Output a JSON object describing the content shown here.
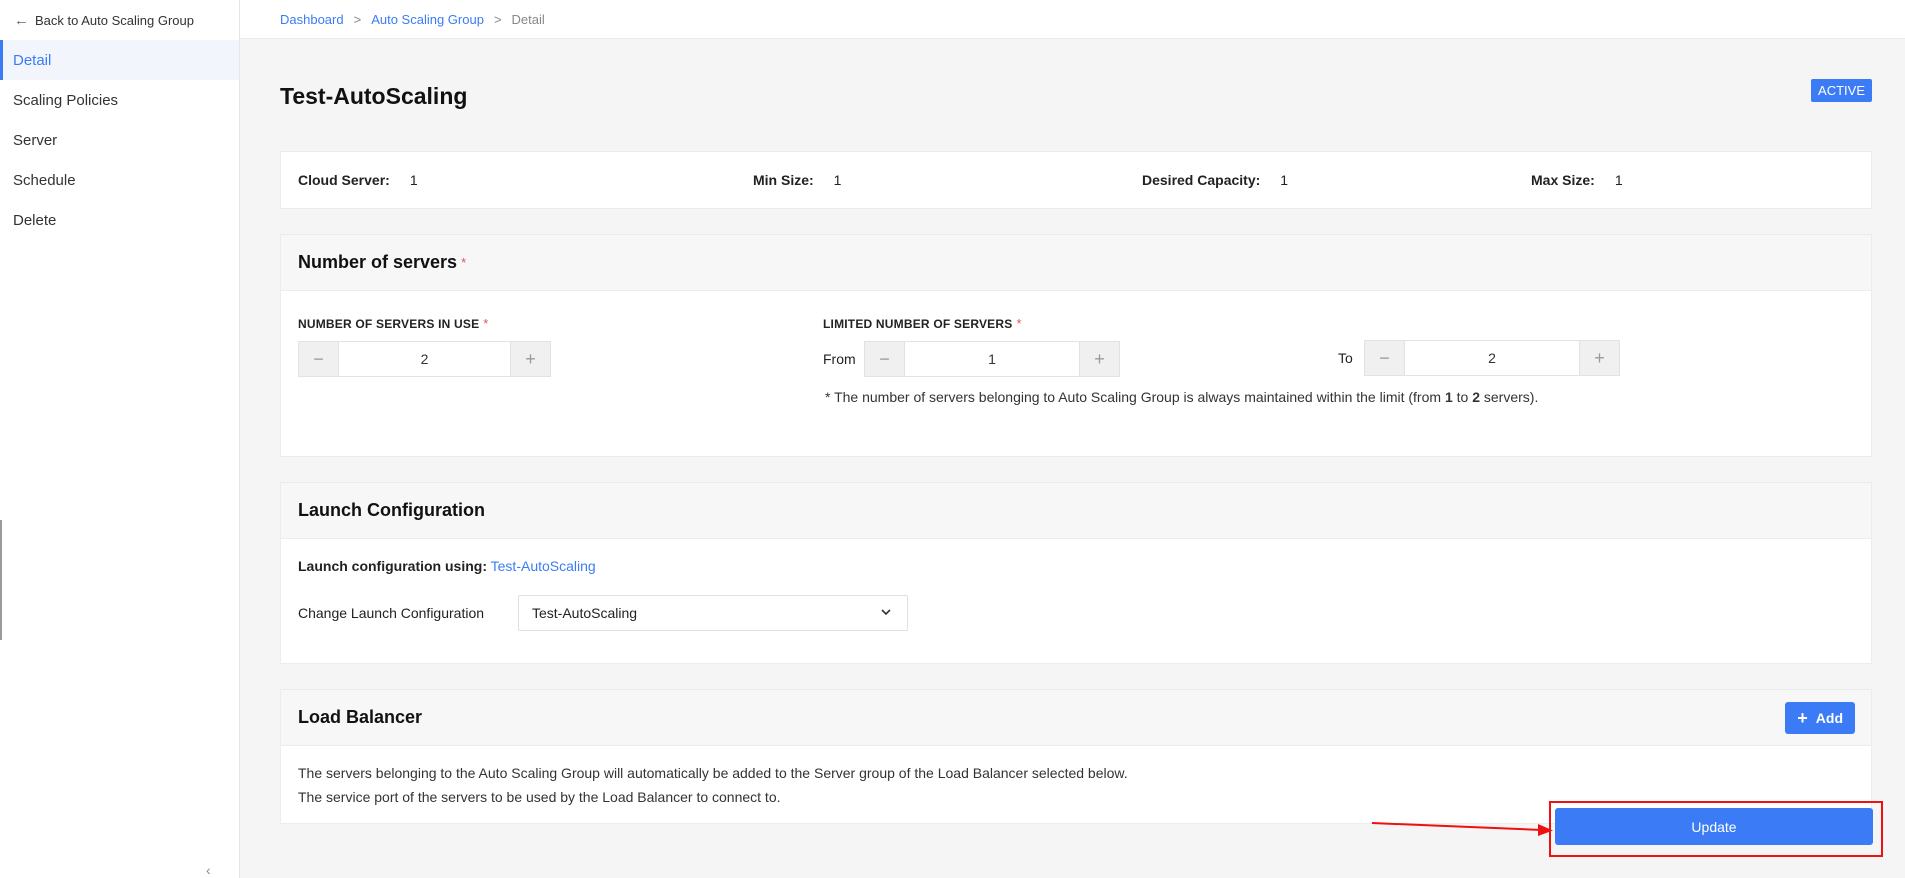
{
  "sidebar": {
    "back_label": "Back to Auto Scaling Group",
    "items": [
      {
        "label": "Detail",
        "active": true
      },
      {
        "label": "Scaling Policies"
      },
      {
        "label": "Server"
      },
      {
        "label": "Schedule"
      },
      {
        "label": "Delete"
      }
    ]
  },
  "breadcrumb": {
    "items": [
      "Dashboard",
      "Auto Scaling Group",
      "Detail"
    ],
    "separator": ">"
  },
  "page": {
    "title": "Test-AutoScaling",
    "status": "ACTIVE"
  },
  "summary": {
    "cloud_server_label": "Cloud Server:",
    "cloud_server_value": "1",
    "min_size_label": "Min Size:",
    "min_size_value": "1",
    "desired_label": "Desired Capacity:",
    "desired_value": "1",
    "max_size_label": "Max Size:",
    "max_size_value": "1"
  },
  "servers_section": {
    "title": "Number of servers",
    "required_mark": "*",
    "in_use_label": "NUMBER OF SERVERS IN USE",
    "in_use_value": "2",
    "limited_label": "LIMITED NUMBER OF SERVERS",
    "from_label": "From",
    "from_value": "1",
    "to_label": "To",
    "to_value": "2",
    "note_prefix": "* The number of servers belonging to Auto Scaling Group is always maintained within the limit (from ",
    "note_from": "1",
    "note_mid": " to ",
    "note_to": "2",
    "note_suffix": " servers)."
  },
  "launch_section": {
    "title": "Launch Configuration",
    "using_label": "Launch configuration using:",
    "using_value": "Test-AutoScaling",
    "change_label": "Change Launch Configuration",
    "selected": "Test-AutoScaling"
  },
  "lb_section": {
    "title": "Load Balancer",
    "add_label": "Add",
    "desc_line1": "The servers belonging to the Auto Scaling Group will automatically be added to the Server group of the Load Balancer selected below.",
    "desc_line2": "The service port of the servers to be used by the Load Balancer to connect to."
  },
  "actions": {
    "update_label": "Update"
  },
  "colors": {
    "accent": "#3b7cf6",
    "required": "#e05555",
    "annotation": "#e11111"
  },
  "icons": {
    "back": "arrow-left-icon",
    "minus": "minus-icon",
    "plus": "plus-icon",
    "chevron": "chevron-down-icon",
    "collapse": "chevron-left-icon"
  }
}
